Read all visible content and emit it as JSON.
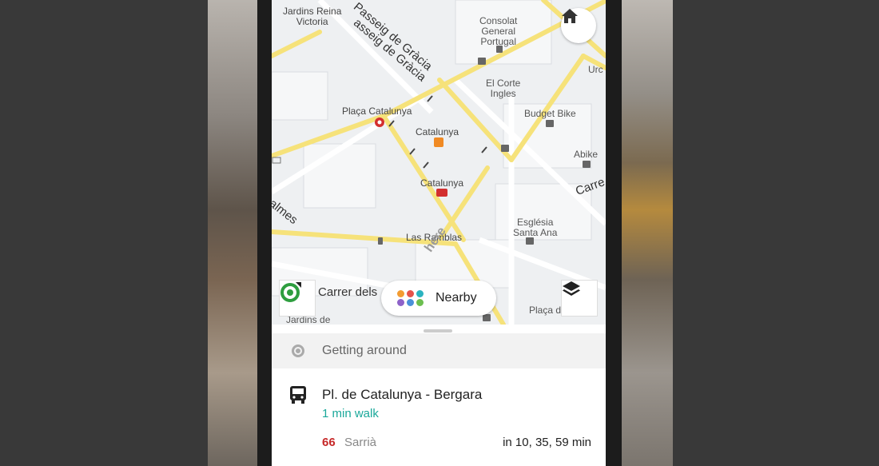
{
  "map": {
    "labels": {
      "jardins_reina": "Jardins Reina\nVictoria",
      "passeig_gracia_1": "Passeig de Gràcia",
      "passeig_gracia_2": "asseig de Gràcia",
      "consolat": "Consolat\nGeneral\nPortugal",
      "el_corte": "El Corte\nIngles",
      "budget_bike": "Budget Bike",
      "urc": "Urc",
      "placa_catalunya": "Plaça Catalunya",
      "catalunya_rail": "Catalunya",
      "catalunya_metro": "Catalunya",
      "abike": "Abike",
      "carre": "Carre",
      "esglesia": "Església\nSanta Ana",
      "las_ramblas": "Las Ramblas",
      "almes": "almes",
      "carrer": "Carrer  dels",
      "jardins_de": "Jardins de",
      "placa_de": "Plaça de",
      "watermark": "here"
    }
  },
  "buttons": {
    "home_icon": "home-icon",
    "locate_icon": "locate-icon",
    "layers_icon": "layers-icon",
    "nearby_label": "Nearby"
  },
  "sheet": {
    "getting_around": "Getting around",
    "stop": {
      "name": "Pl. de Catalunya - Bergara",
      "walk": "1 min walk",
      "route_number": "66",
      "route_destination": "Sarrià",
      "times": "in 10, 35, 59 min"
    }
  },
  "colors": {
    "accent_teal": "#1aa89a",
    "route_red": "#c62828",
    "locate_green": "#2e9e3f",
    "road_yellow": "#f6e27a"
  }
}
